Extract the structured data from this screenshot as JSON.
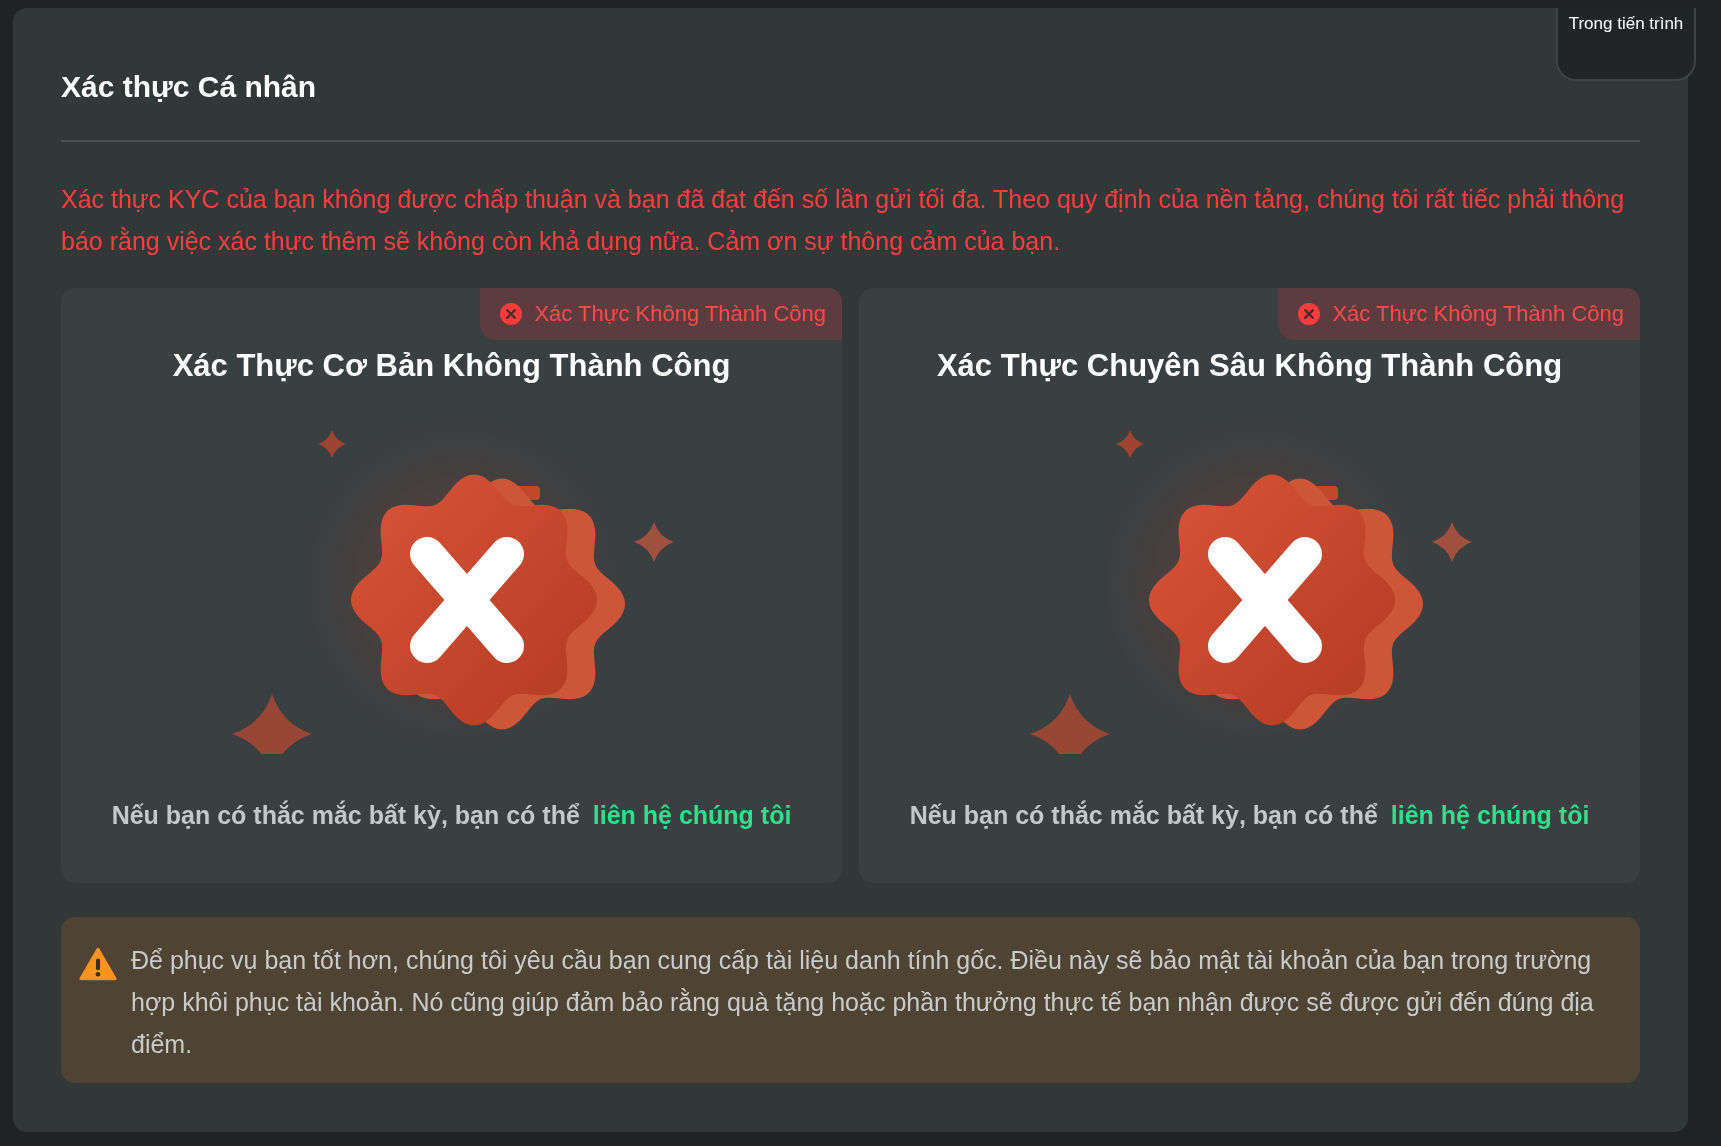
{
  "header": {
    "title": "Xác thực Cá nhân"
  },
  "tooltip": {
    "text": "Trong tiến trình"
  },
  "alert": "Xác thực KYC của bạn không được chấp thuận và bạn đã đạt đến số lần gửi tối đa. Theo quy định của nền tảng, chúng tôi rất tiếc phải thông báo rằng việc xác thực thêm sẽ không còn khả dụng nữa. Cảm ơn sự thông cảm của bạn.",
  "cards": [
    {
      "status": {
        "kind": "failed",
        "label": "Xác Thực Không Thành Công"
      },
      "title": "Xác Thực Cơ Bản Không Thành Công",
      "help_text": "Nếu bạn có thắc mắc bất kỳ, bạn có thể",
      "link": "liên hệ chúng tôi"
    },
    {
      "status": {
        "kind": "failed",
        "label": "Xác Thực Không Thành Công"
      },
      "title": "Xác Thực Chuyên Sâu Không Thành Công",
      "help_text": "Nếu bạn có thắc mắc bất kỳ, bạn có thể",
      "link": "liên hệ chúng tôi"
    }
  ],
  "notice": {
    "kind": "warning",
    "text": "Để phục vụ bạn tốt hơn, chúng tôi yêu cầu bạn cung cấp tài liệu danh tính gốc. Điều này sẽ bảo mật tài khoản của bạn trong trường hợp khôi phục tài khoản. Nó cũng giúp đảm bảo rằng quà tặng hoặc phần thưởng thực tế bạn nhận được sẽ được gửi đến đúng địa điểm."
  }
}
